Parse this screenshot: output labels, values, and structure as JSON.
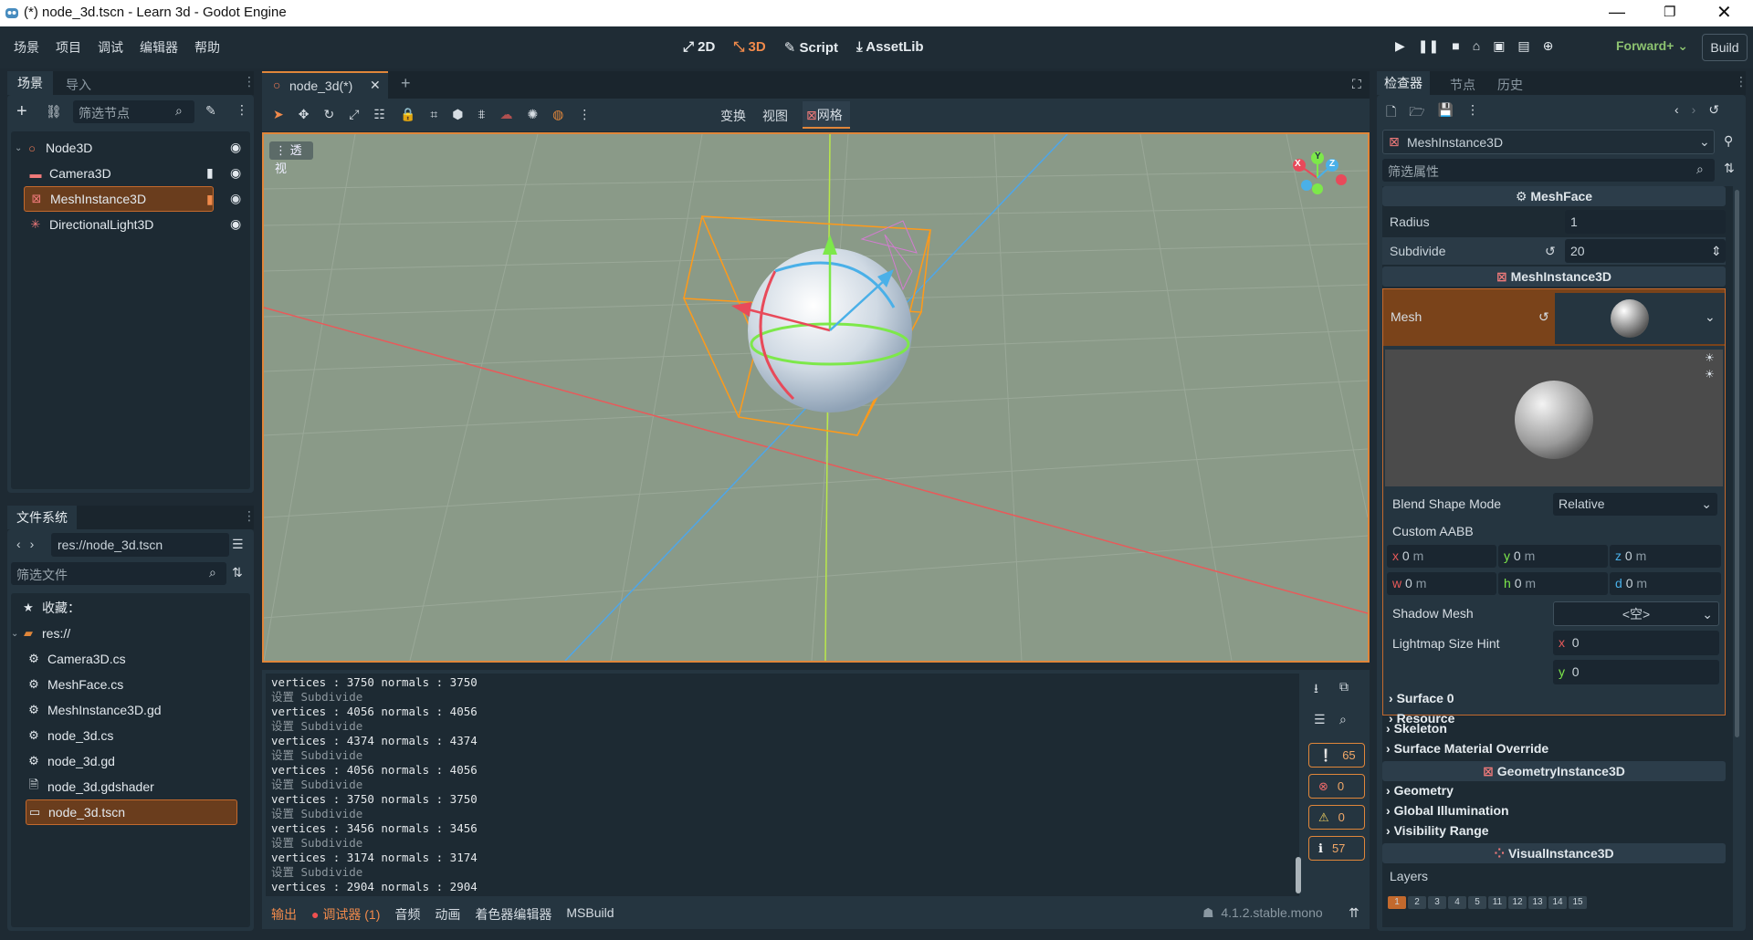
{
  "window": {
    "title": "(*) node_3d.tscn - Learn 3d - Godot Engine"
  },
  "menu": [
    "场景",
    "项目",
    "调试",
    "编辑器",
    "帮助"
  ],
  "workspaces": {
    "w2d": "2D",
    "w3d": "3D",
    "script": "Script",
    "assetlib": "AssetLib"
  },
  "run": {
    "renderer": "Forward+",
    "build": "Build"
  },
  "scene_dock": {
    "tabs": [
      "场景",
      "导入"
    ],
    "filter_placeholder": "筛选节点",
    "nodes": [
      {
        "name": "Node3D",
        "icon": "node3d-icon"
      },
      {
        "name": "Camera3D",
        "icon": "camera-icon"
      },
      {
        "name": "MeshInstance3D",
        "icon": "mesh-instance-icon"
      },
      {
        "name": "DirectionalLight3D",
        "icon": "light-icon"
      }
    ]
  },
  "fs_dock": {
    "tab": "文件系统",
    "path": "res://node_3d.tscn",
    "filter_placeholder": "筛选文件",
    "favorites": "收藏：",
    "root": "res://",
    "files": [
      "Camera3D.cs",
      "MeshFace.cs",
      "MeshInstance3D.gd",
      "node_3d.cs",
      "node_3d.gd",
      "node_3d.gdshader",
      "node_3d.tscn"
    ]
  },
  "editor": {
    "tab": "node_3d(*)",
    "menus": {
      "transform": "变换",
      "view": "视图",
      "mesh": "网格"
    },
    "perspective": "透视"
  },
  "gizmo": {
    "x": "X",
    "y": "Y",
    "z": "Z"
  },
  "console": {
    "lines": [
      {
        "t": "vertices : 3750 normals : 3750",
        "dim": false
      },
      {
        "t": "设置 Subdivide",
        "dim": true
      },
      {
        "t": "vertices : 4056 normals : 4056",
        "dim": false
      },
      {
        "t": "设置 Subdivide",
        "dim": true
      },
      {
        "t": "vertices : 4374 normals : 4374",
        "dim": false
      },
      {
        "t": "设置 Subdivide",
        "dim": true
      },
      {
        "t": "vertices : 4056 normals : 4056",
        "dim": false
      },
      {
        "t": "设置 Subdivide",
        "dim": true
      },
      {
        "t": "vertices : 3750 normals : 3750",
        "dim": false
      },
      {
        "t": "设置 Subdivide",
        "dim": true
      },
      {
        "t": "vertices : 3456 normals : 3456",
        "dim": false
      },
      {
        "t": "设置 Subdivide",
        "dim": true
      },
      {
        "t": "vertices : 3174 normals : 3174",
        "dim": false
      },
      {
        "t": "设置 Subdivide",
        "dim": true
      },
      {
        "t": "vertices : 2904 normals : 2904",
        "dim": false
      }
    ],
    "counts": {
      "messages": "65",
      "errors": "0",
      "warnings": "0",
      "info": "57"
    }
  },
  "bottom_tabs": {
    "output": "输出",
    "debugger": "调试器 (1)",
    "audio": "音频",
    "animation": "动画",
    "shader": "着色器编辑器",
    "msbuild": "MSBuild",
    "version": "4.1.2.stable.mono"
  },
  "inspector": {
    "tabs": [
      "检查器",
      "节点",
      "历史"
    ],
    "object": "MeshInstance3D",
    "filter_placeholder": "筛选属性",
    "meshface": {
      "title": "MeshFace",
      "radius_label": "Radius",
      "radius": "1",
      "subdivide_label": "Subdivide",
      "subdivide": "20"
    },
    "meshinstance": {
      "title": "MeshInstance3D",
      "mesh_label": "Mesh",
      "blend_label": "Blend Shape Mode",
      "blend": "Relative",
      "aabb_label": "Custom AABB",
      "aabb": {
        "x": "0",
        "y": "0",
        "z": "0",
        "w": "0",
        "h": "0",
        "d": "0"
      },
      "unit": "m",
      "shadow_label": "Shadow Mesh",
      "shadow": "<空>",
      "lightmap_label": "Lightmap Size Hint",
      "lightmap_x": "0",
      "lightmap_y": "0",
      "surface": "Surface 0",
      "resource": "Resource",
      "skeleton": "Skeleton",
      "surface_override": "Surface Material Override"
    },
    "geometry": {
      "title": "GeometryInstance3D",
      "items": [
        "Geometry",
        "Global Illumination",
        "Visibility Range"
      ]
    },
    "visual": {
      "title": "VisualInstance3D",
      "layers": "Layers",
      "layer_nums": [
        "1",
        "2",
        "3",
        "4",
        "5",
        "11",
        "12",
        "13",
        "14",
        "15"
      ]
    }
  },
  "colors": {
    "accent": "#e0863a",
    "bg": "#1e2a33",
    "panel": "#253540",
    "viewport": "#8a9a88"
  }
}
